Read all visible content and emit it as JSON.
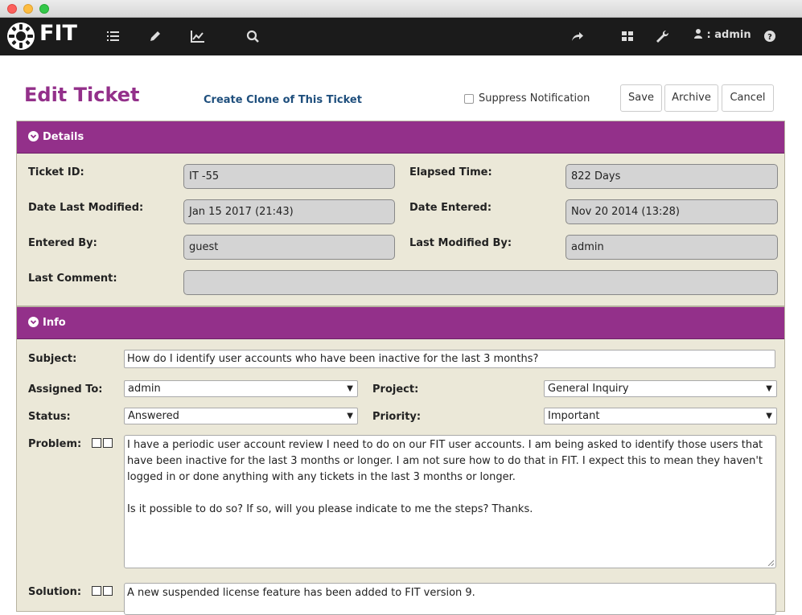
{
  "app": {
    "logo_text": "FIT"
  },
  "nav": {
    "user": ": admin"
  },
  "header": {
    "title": "Edit Ticket",
    "clone_link": "Create Clone of This Ticket",
    "suppress_label": "Suppress Notification",
    "suppress_checked": false,
    "save_label": "Save",
    "archive_label": "Archive",
    "cancel_label": "Cancel"
  },
  "details": {
    "heading": "Details",
    "ticket_id_label": "Ticket ID:",
    "ticket_id": "IT -55",
    "elapsed_label": "Elapsed Time:",
    "elapsed": "822 Days",
    "date_modified_label": "Date Last Modified:",
    "date_modified": "Jan 15 2017 (21:43)",
    "date_entered_label": "Date Entered:",
    "date_entered": "Nov 20 2014 (13:28)",
    "entered_by_label": "Entered By:",
    "entered_by": "guest",
    "modified_by_label": "Last Modified By:",
    "modified_by": "admin",
    "last_comment_label": "Last Comment:",
    "last_comment": ""
  },
  "info": {
    "heading": "Info",
    "subject_label": "Subject:",
    "subject": "How do I identify user accounts who have been inactive for the last 3 months?",
    "assigned_label": "Assigned To:",
    "assigned": "admin",
    "project_label": "Project:",
    "project": "General Inquiry",
    "status_label": "Status:",
    "status": "Answered",
    "priority_label": "Priority:",
    "priority": "Important",
    "problem_label": "Problem:",
    "problem_p1": "I have a periodic user account review I need to do on our FIT user accounts.  I am being asked to identify those users that have been inactive for the last 3 months or longer.  I am not sure how to do that in FIT.  I expect this to mean they haven't logged in or done anything with any tickets in the last 3 months or longer.",
    "problem_p2": "Is it possible to do so?  If so, will you please indicate to me the steps?  Thanks.",
    "solution_label": "Solution:",
    "solution": "A new suspended license feature has been added to FIT version 9."
  },
  "icons": {
    "nav": [
      "list-icon",
      "pencil-icon",
      "chart-icon",
      "search-icon",
      "share-icon",
      "grid-icon",
      "wrench-icon",
      "user-icon",
      "help-icon"
    ]
  },
  "colors": {
    "accent": "#93308a",
    "panel_bg": "#ebe8d8",
    "navbar_bg": "#1b1b1b"
  }
}
